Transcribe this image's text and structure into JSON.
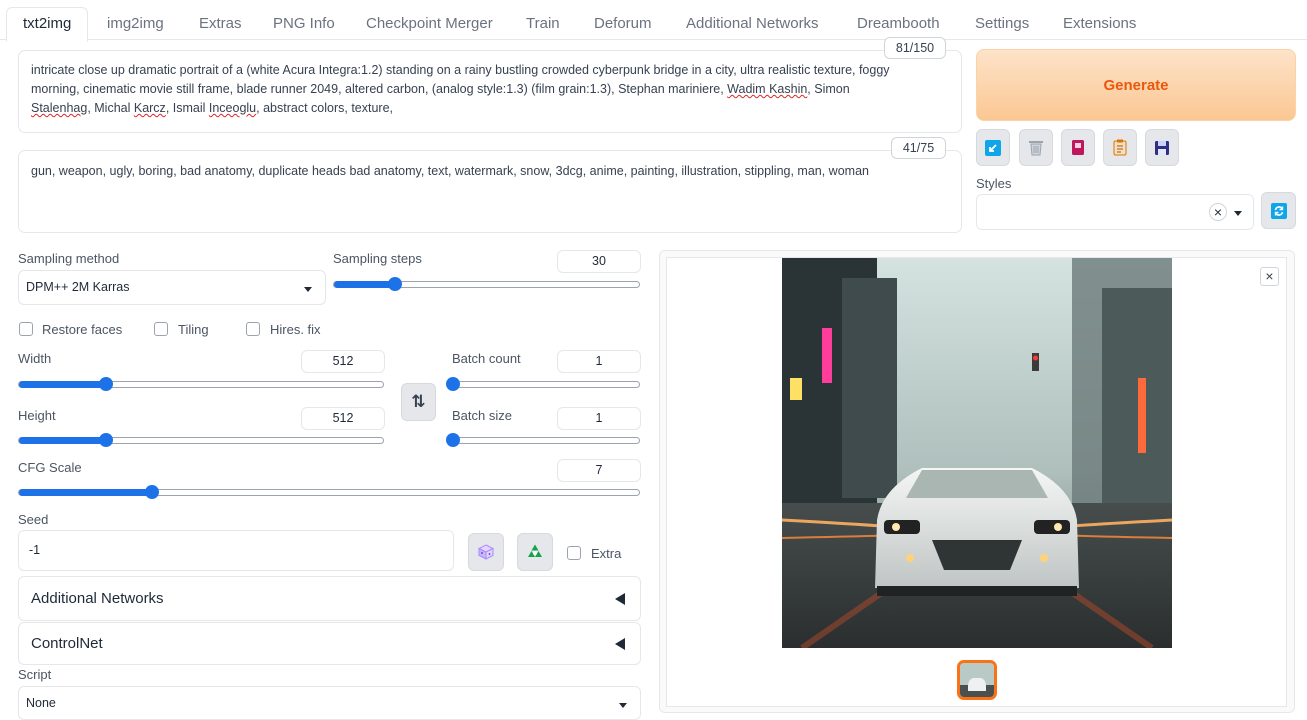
{
  "tabs": [
    "txt2img",
    "img2img",
    "Extras",
    "PNG Info",
    "Checkpoint Merger",
    "Train",
    "Deforum",
    "Additional Networks",
    "Dreambooth",
    "Settings",
    "Extensions"
  ],
  "prompt": {
    "counter": "81/150",
    "line1": "intricate close up dramatic portrait of a (white Acura Integra:1.2) standing on a rainy bustling crowded cyberpunk bridge in a city, ultra realistic texture, foggy",
    "line2": "morning, cinematic movie still frame, blade runner 2049, altered carbon, (analog style:1.3) (film grain:1.3), Stephan mariniere, ",
    "line2_u1": "Wadim Kashin",
    "line2_end": ", Simon",
    "line3_u1": "Stalenhag",
    "line3_b": ", Michal ",
    "line3_u2": "Karcz",
    "line3_c": ", Ismail ",
    "line3_u3": "Inceoglu",
    "line3_end": ", abstract colors, texture,"
  },
  "negative": {
    "counter": "41/75",
    "text": "gun, weapon, ugly, boring, bad anatomy, duplicate heads bad anatomy, text, watermark, snow, 3dcg, anime, painting, illustration, stippling, man, woman"
  },
  "generate_label": "Generate",
  "styles": {
    "label": "Styles",
    "clear_glyph": "×"
  },
  "sampling": {
    "method_label": "Sampling method",
    "method_value": "DPM++ 2M Karras",
    "steps_label": "Sampling steps",
    "steps_value": "30",
    "steps_fraction": 0.2
  },
  "checkboxes": {
    "restore_faces": "Restore faces",
    "tiling": "Tiling",
    "hires": "Hires. fix",
    "extra": "Extra"
  },
  "width": {
    "label": "Width",
    "value": "512",
    "fraction": 0.24
  },
  "height": {
    "label": "Height",
    "value": "512",
    "fraction": 0.24
  },
  "batch_count": {
    "label": "Batch count",
    "value": "1",
    "fraction": 0.0
  },
  "batch_size": {
    "label": "Batch size",
    "value": "1",
    "fraction": 0.0
  },
  "cfg": {
    "label": "CFG Scale",
    "value": "7",
    "fraction": 0.215
  },
  "seed": {
    "label": "Seed",
    "value": "-1"
  },
  "swap_glyph": "⇅",
  "accordions": {
    "additional_networks": "Additional Networks",
    "controlnet": "ControlNet"
  },
  "script": {
    "label": "Script",
    "value": "None"
  },
  "gallery": {
    "close_glyph": "×"
  },
  "colors": {
    "accent": "#1d72e8",
    "generate_text": "#ea580c"
  }
}
